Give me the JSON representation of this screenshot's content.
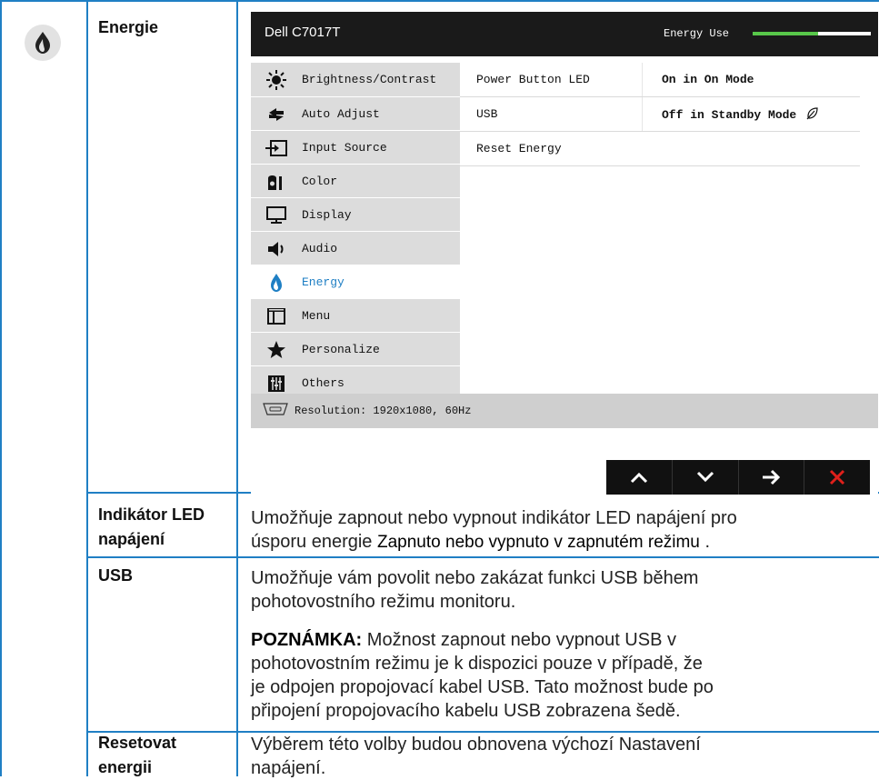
{
  "section": {
    "energy_title": "Energie",
    "flame_icon": "flame-icon"
  },
  "osd": {
    "model": "Dell C7017T",
    "energy_use_label": "Energy Use",
    "energy_use_level": 0.55,
    "menu": [
      {
        "label": "Brightness/Contrast",
        "icon": "brightness-icon"
      },
      {
        "label": "Auto Adjust",
        "icon": "auto-adjust-icon"
      },
      {
        "label": "Input Source",
        "icon": "input-source-icon"
      },
      {
        "label": "Color",
        "icon": "color-icon"
      },
      {
        "label": "Display",
        "icon": "display-icon"
      },
      {
        "label": "Audio",
        "icon": "audio-icon"
      },
      {
        "label": "Energy",
        "icon": "energy-icon",
        "selected": true
      },
      {
        "label": "Menu",
        "icon": "menu-icon"
      },
      {
        "label": "Personalize",
        "icon": "star-icon"
      },
      {
        "label": "Others",
        "icon": "others-icon"
      }
    ],
    "submenu": [
      {
        "name": "Power Button LED",
        "value": "On in On Mode"
      },
      {
        "name": "USB",
        "value": "Off in Standby Mode"
      },
      {
        "name": "Reset Energy",
        "value": ""
      }
    ],
    "resolution": "Resolution: 1920x1080, 60Hz",
    "nav": [
      "up-arrow-icon",
      "down-arrow-icon",
      "right-arrow-icon",
      "close-icon"
    ],
    "colors": {
      "accent": "#1f7fc4",
      "energy_bar": "#58c84a",
      "close": "#e0201b"
    }
  },
  "rows": {
    "led_label_1": "Indikátor LED",
    "led_label_2": "napájení",
    "led_text_1": "Umožňuje zapnout nebo vypnout indikátor LED napájení pro",
    "led_text_2": "úsporu energie",
    "led_highlight": "Zapnuto nebo vypnuto v zapnutém režimu",
    "led_text_3": ".",
    "usb_label": "USB",
    "usb_text_1": "Umožňuje vám povolit nebo zakázat funkci USB během",
    "usb_text_2": "pohotovostního režimu monitoru.",
    "note_label": "POZNÁMKA:",
    "note_text_1": "Možnost zapnout nebo vypnout USB v",
    "note_text_2": "pohotovostním režimu je k dispozici pouze v případě, že",
    "note_text_3": "je odpojen propojovací kabel USB. Tato možnost bude po",
    "note_text_4": "připojení propojovacího kabelu USB zobrazena šedě.",
    "reset_label_1": "Resetovat",
    "reset_label_2": "energii",
    "reset_text_1": "Výběrem této volby budou obnovena výchozí Nastavení",
    "reset_text_2": "napájení."
  }
}
